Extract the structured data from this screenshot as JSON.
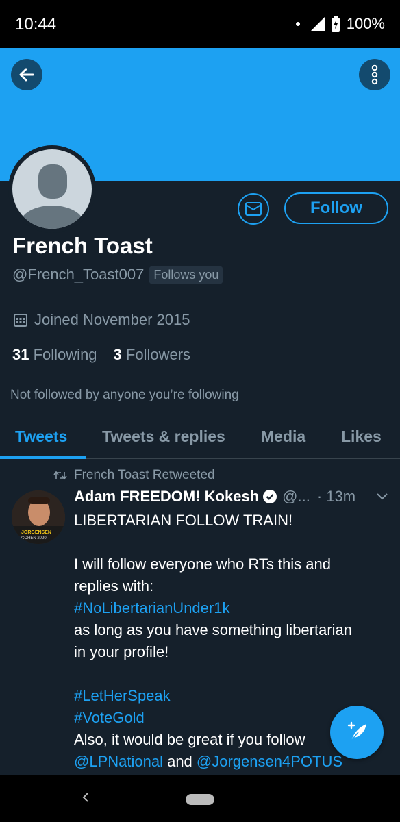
{
  "status_bar": {
    "time": "10:44",
    "battery": "100%"
  },
  "profile": {
    "name": "French Toast",
    "handle": "@French_Toast007",
    "follows_you": "Follows you",
    "joined": "Joined November 2015",
    "following_count": "31",
    "following_label": "Following",
    "followers_count": "3",
    "followers_label": "Followers",
    "not_followed": "Not followed by anyone you’re following",
    "follow_button": "Follow"
  },
  "tabs": [
    {
      "label": "Tweets",
      "active": true
    },
    {
      "label": "Tweets & replies",
      "active": false
    },
    {
      "label": "Media",
      "active": false
    },
    {
      "label": "Likes",
      "active": false
    }
  ],
  "tweet": {
    "retweeted_by": "French Toast Retweeted",
    "author": "Adam FREEDOM! Kokesh",
    "handle": "@...",
    "time": "· 13m",
    "avatar_caption_1": "JORGENSEN",
    "avatar_caption_2": "COHEN 2020",
    "lines": {
      "l1": "LIBERTARIAN FOLLOW TRAIN!",
      "l2": "I will follow everyone who RTs this and",
      "l3": "replies with:",
      "l4": "#NoLibertarianUnder1k",
      "l5": "as long as you have something libertarian",
      "l6": "in your profile!",
      "l7": "#LetHerSpeak",
      "l8": "#VoteGold",
      "l9": "Also, it would be great if you follow",
      "l10a": "@LPNational",
      "l10b": " and ",
      "l10c": "@Jorgensen4POTUS"
    }
  },
  "colors": {
    "accent": "#1da1f2",
    "background": "#15202b",
    "secondary_text": "#8899a6"
  }
}
